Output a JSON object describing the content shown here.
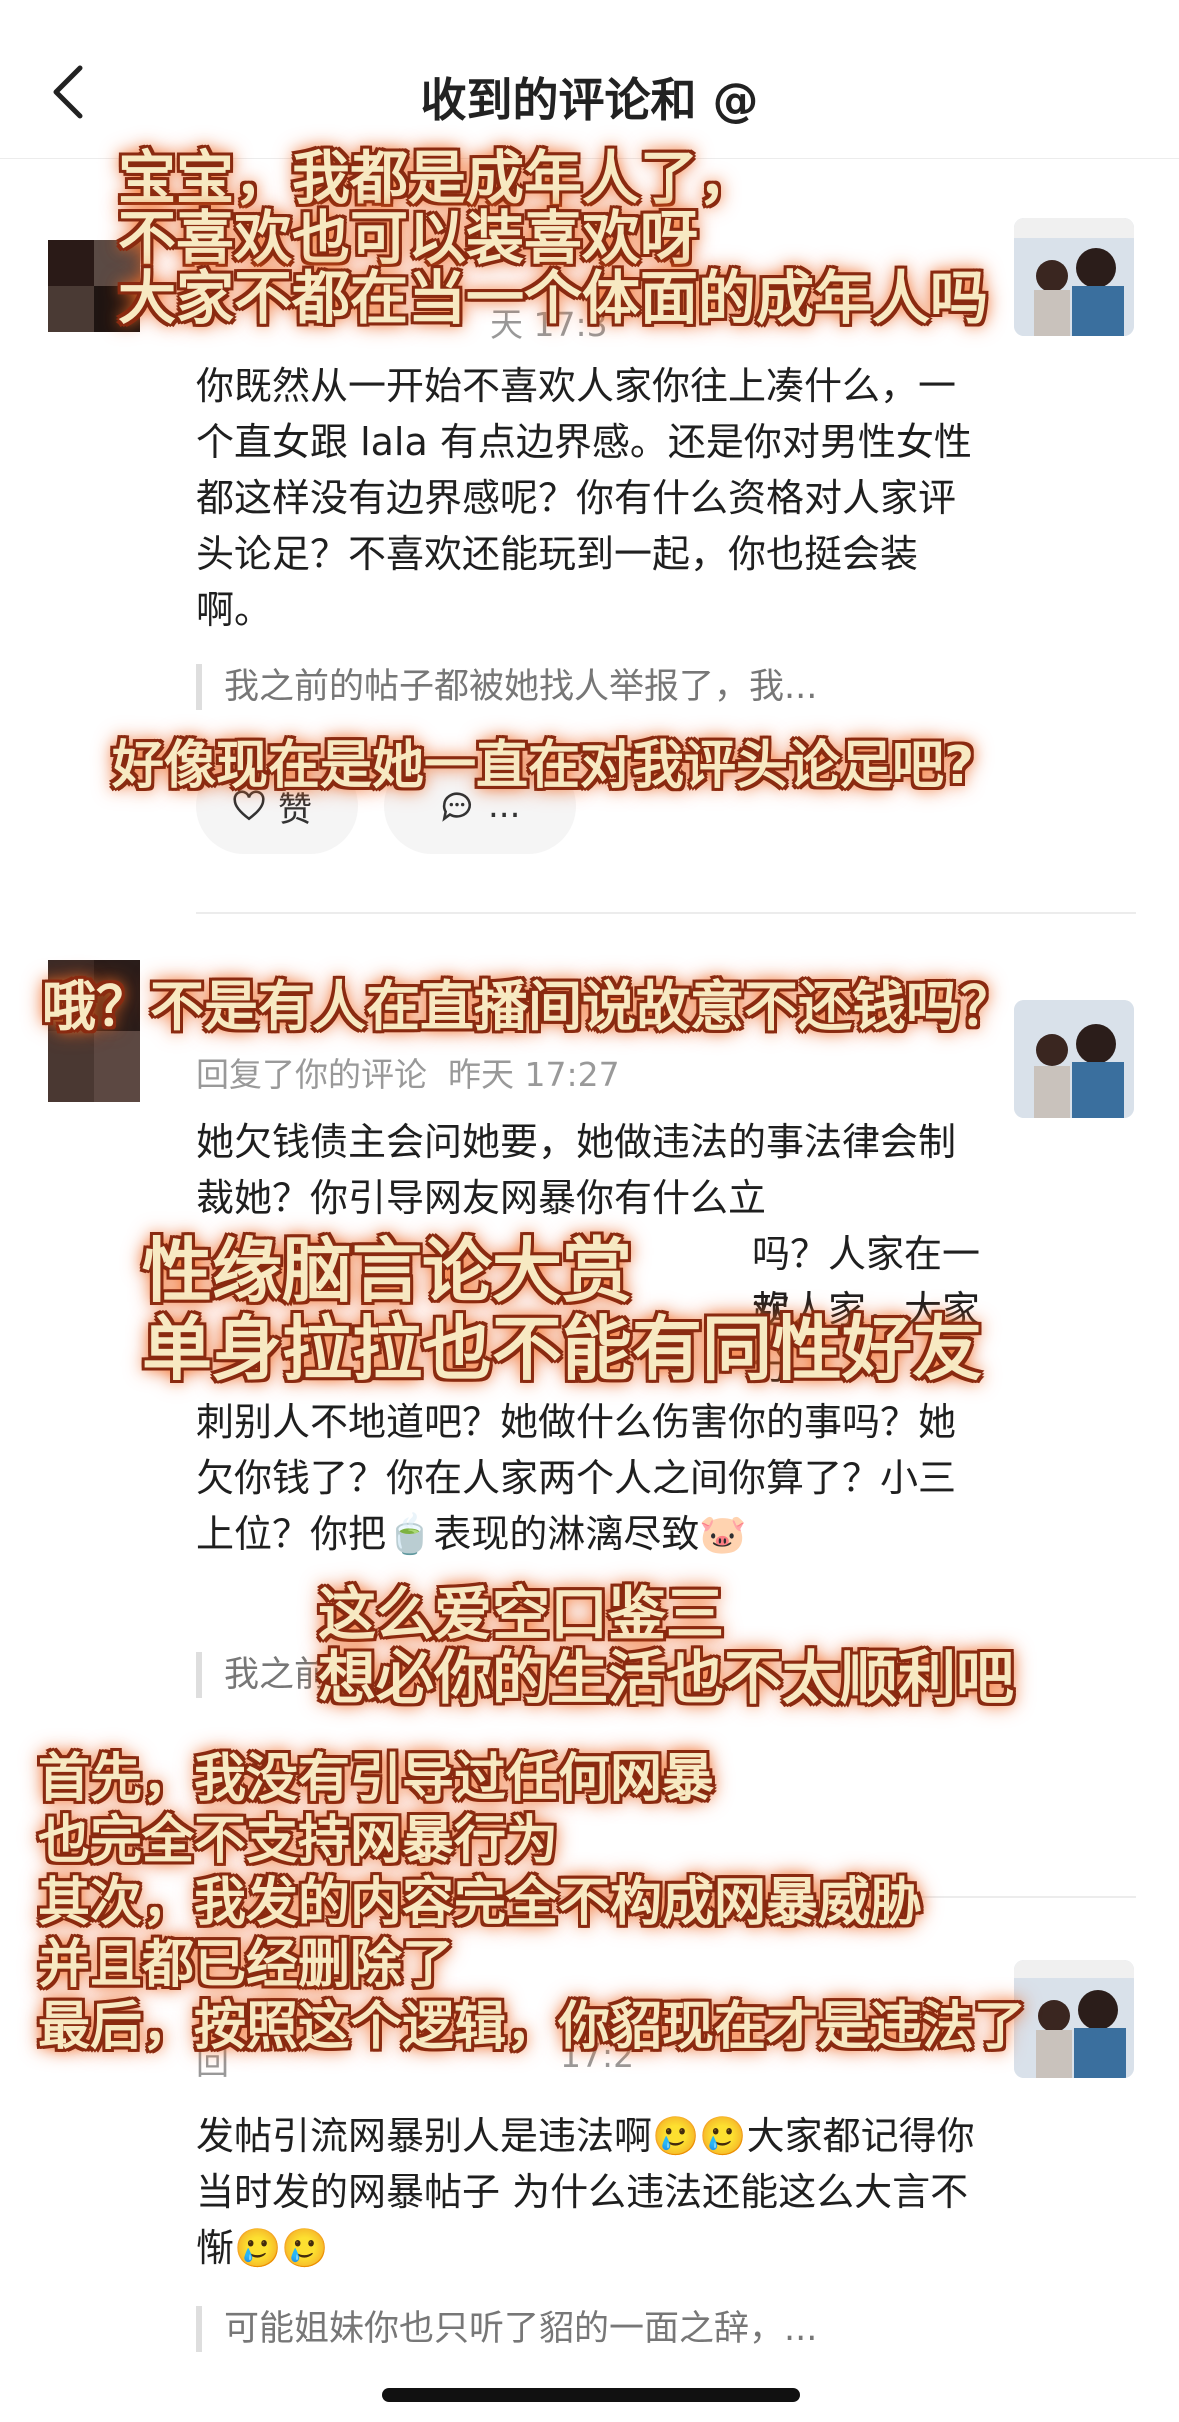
{
  "header": {
    "title": "收到的评论和 @"
  },
  "comment1": {
    "time": "天 17:3",
    "body": "你既然从一开始不喜欢人家你往上凑什么，一个直女跟 lala 有点边界感。还是你对男性女性都这样没有边界感呢？你有什么资格对人家评头论足？不喜欢还能玩到一起，你也挺会装啊。",
    "quote": "我之前的帖子都被她找人举报了，我...",
    "like_label": "赞",
    "reply_label": "..."
  },
  "comment2": {
    "meta": "回复了你的评论  昨天 17:27",
    "body_top": "她欠钱债主会问她要，她做违法的事法律会制裁她？你引导网友网暴你有什么立",
    "body_frag1": "吗？人家在一起",
    "body_frag2": "欢人家，大家分",
    "body_bottom": "刺别人不地道吧？她做什么伤害你的事吗？她欠你钱了？你在人家两个人之间你算了？小三上位？你把🍵表现的淋漓尽致🐷",
    "quote": "我之前"
  },
  "comment3": {
    "meta": "回",
    "time": "17:2",
    "body": "发帖引流网暴别人是违法啊🥲🥲大家都记得你当时发的网暴帖子 为什么违法还能这么大言不惭🥲🥲",
    "quote": "可能姐妹你也只听了貂的一面之辞，..."
  },
  "overlays": {
    "o1": [
      "宝宝，我都是成年人了，",
      "不喜欢也可以装喜欢呀",
      "大家不都在当一个体面的成年人吗"
    ],
    "o2": [
      "好像现在是她一直在对我评头论足吧?"
    ],
    "o3": [
      "哦？不是有人在直播间说故意不还钱吗？"
    ],
    "o4": [
      "性缘脑言论大赏",
      "单身拉拉也不能有同性好友"
    ],
    "o5": [
      "这么爱空口鉴三",
      "想必你的生活也不太顺利吧"
    ],
    "o6": [
      "首先，我没有引导过任何网暴",
      "也完全不支持网暴行为",
      "其次，我发的内容完全不构成网暴威胁",
      "并且都已经删除了",
      "最后，按照这个逻辑，你貂现在才是违法了"
    ]
  }
}
